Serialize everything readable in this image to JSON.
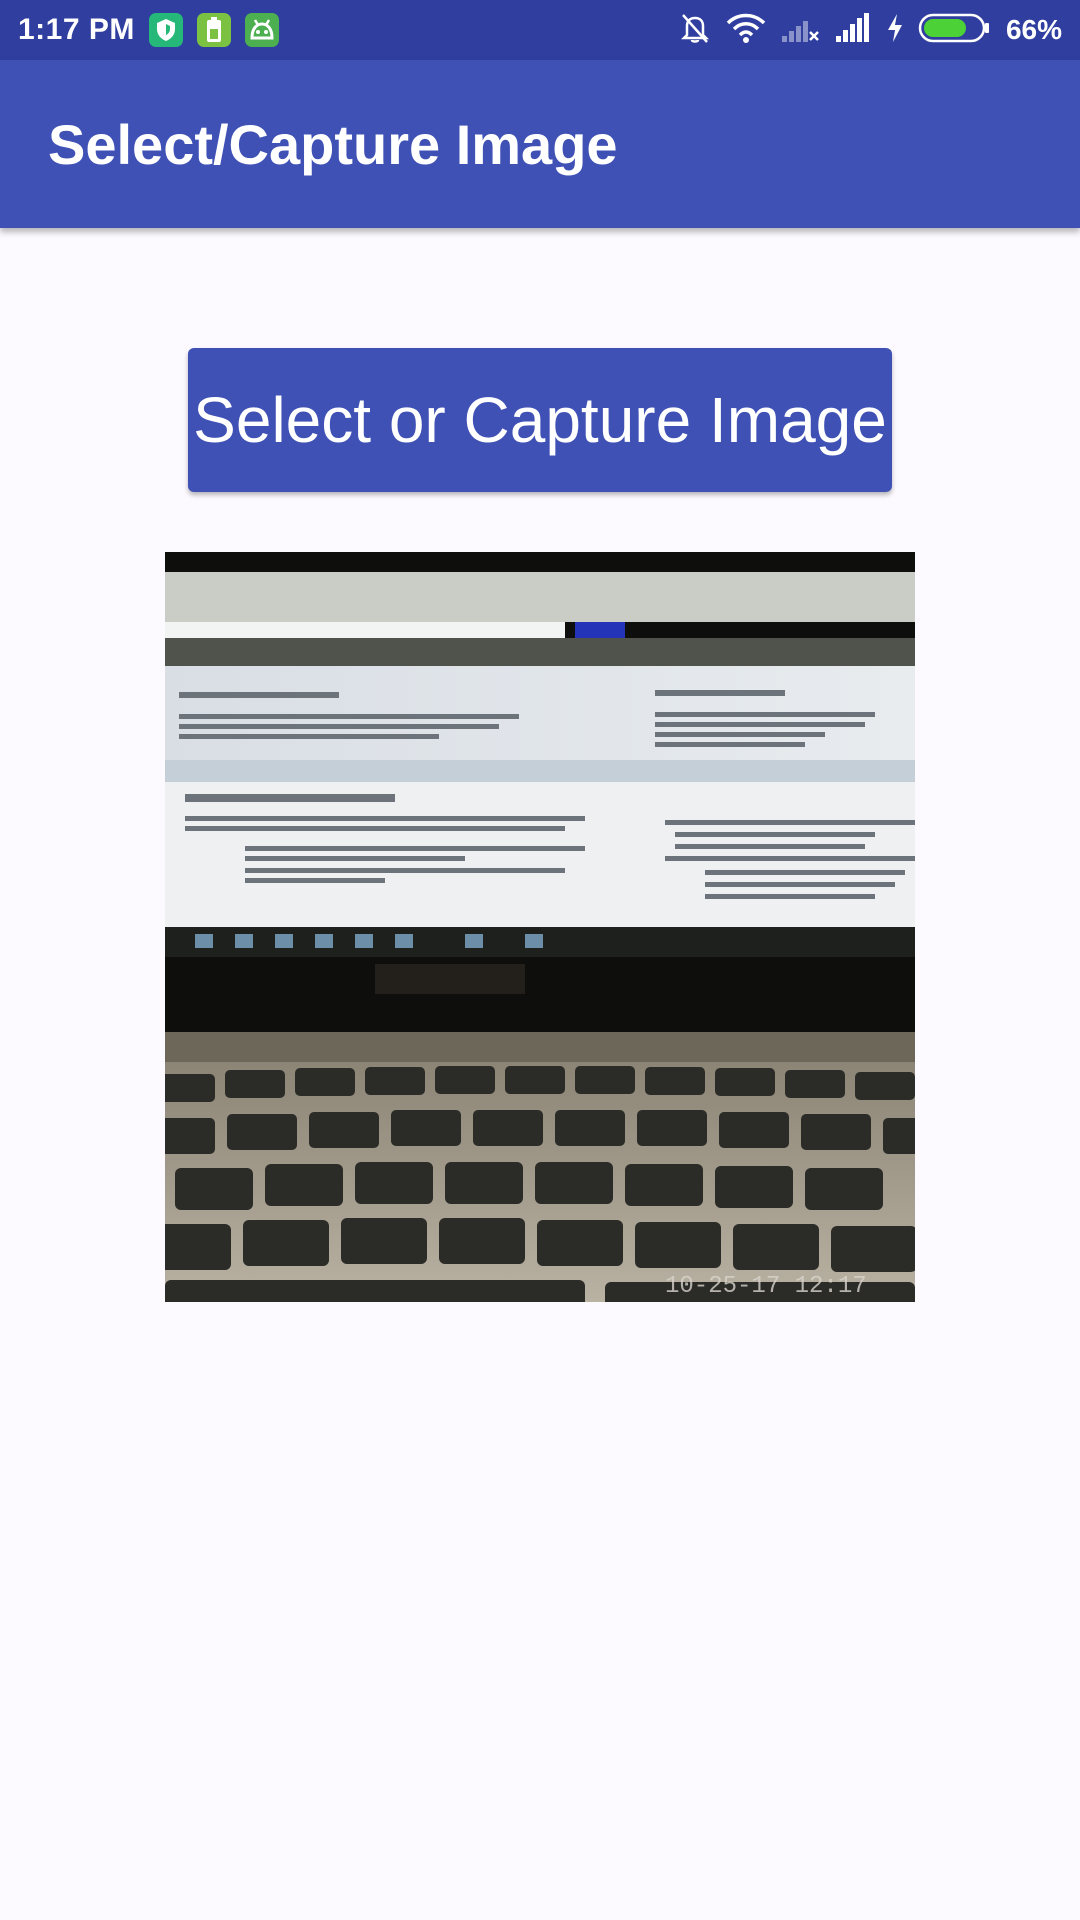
{
  "status_bar": {
    "time": "1:17 PM",
    "battery_percent": "66%",
    "icons_left": [
      "shield-icon",
      "battery-app-icon",
      "android-icon"
    ],
    "icons_right": [
      "notifications-off-icon",
      "wifi-icon",
      "no-sim-signal-icon",
      "signal-icon",
      "charging-icon",
      "battery-icon"
    ],
    "colors": {
      "background": "#303F9F",
      "battery_fill": "#4CD137"
    }
  },
  "app_bar": {
    "title": "Select/Capture Image",
    "color": "#3F51B5"
  },
  "main": {
    "select_button_label": "Select or Capture Image",
    "image_view": {
      "description_icon": "captured-photo",
      "watermark": "10-25-17 12:17"
    }
  }
}
